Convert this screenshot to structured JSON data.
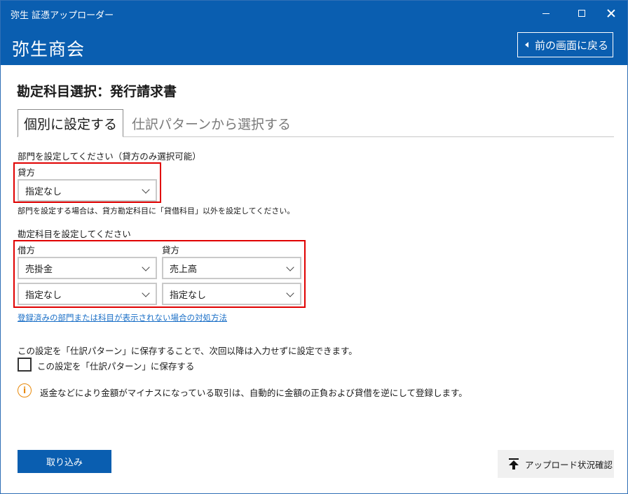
{
  "window": {
    "title": "弥生 証憑アップローダー"
  },
  "header": {
    "company_name": "弥生商会",
    "back_button_label": "前の画面に戻る"
  },
  "page": {
    "title": "勘定科目選択：発行請求書"
  },
  "tabs": [
    {
      "label": "個別に設定する",
      "active": true
    },
    {
      "label": "仕訳パターンから選択する",
      "active": false
    }
  ],
  "department": {
    "section_label": "部門を設定してください（貸方のみ選択可能）",
    "credit_label": "貸方",
    "credit_value": "指定なし",
    "note": "部門を設定する場合は、貸方勘定科目に「貸借科目」以外を設定してください。"
  },
  "account": {
    "section_label": "勘定科目を設定してください",
    "debit_label": "借方",
    "credit_label": "貸方",
    "debit_account": "売掛金",
    "credit_account": "売上高",
    "debit_sub": "指定なし",
    "credit_sub": "指定なし"
  },
  "help_link": "登録済みの部門または科目が表示されない場合の対処方法",
  "pattern": {
    "description": "この設定を「仕訳パターン」に保存することで、次回以降は入力せずに設定できます。",
    "checkbox_label": "この設定を「仕訳パターン」に保存する",
    "checked": false
  },
  "info_message": "返金などにより金額がマイナスになっている取引は、自動的に金額の正負および貸借を逆にして登録します。",
  "buttons": {
    "import_label": "取り込み",
    "upload_status_label": "アップロード状況確認"
  },
  "colors": {
    "brand_blue": "#0a5eb0",
    "highlight_red": "#e00000",
    "info_orange": "#e8890a",
    "link_blue": "#1a6fc7"
  }
}
